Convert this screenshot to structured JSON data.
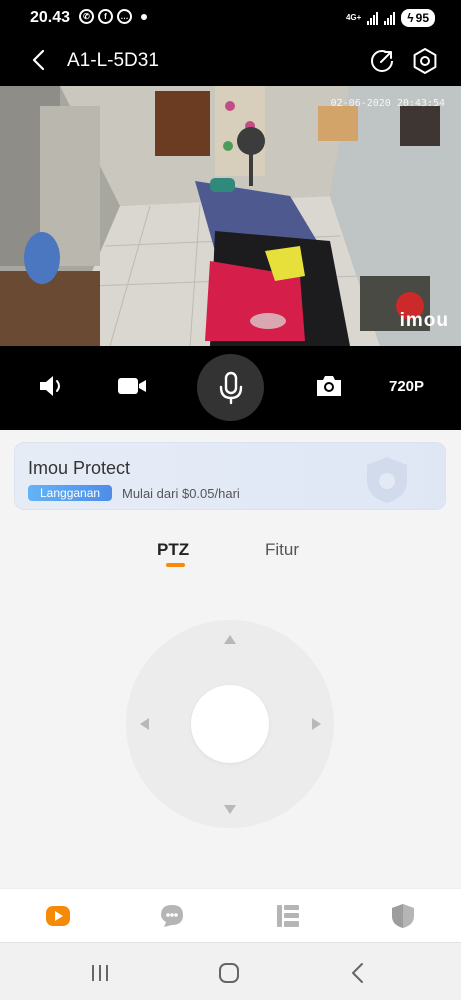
{
  "status_bar": {
    "time": "20.43",
    "notification_icons": [
      "whatsapp-icon",
      "facebook-icon",
      "chat-icon"
    ],
    "network": "4G+",
    "battery": "95"
  },
  "header": {
    "title": "A1-L-5D31",
    "icons": [
      "back-icon",
      "share-icon",
      "settings-icon"
    ]
  },
  "video": {
    "timestamp": "02-06-2020 20:43:54",
    "brand": "imou"
  },
  "controls": {
    "icons": [
      "speaker-icon",
      "record-icon",
      "microphone-icon",
      "camera-icon"
    ],
    "quality": "720P"
  },
  "promo": {
    "title": "Imou Protect",
    "badge": "Langganan",
    "subtitle": "Mulai dari $0.05/hari"
  },
  "tabs": [
    {
      "label": "PTZ",
      "active": true
    },
    {
      "label": "Fitur",
      "active": false
    }
  ],
  "colors": {
    "accent": "#f58a07",
    "badge": "#4f8de8"
  },
  "bottom_nav": [
    "play-icon",
    "message-icon",
    "list-icon",
    "shield-icon"
  ],
  "system_nav": [
    "recents-icon",
    "home-icon",
    "back-nav-icon"
  ]
}
